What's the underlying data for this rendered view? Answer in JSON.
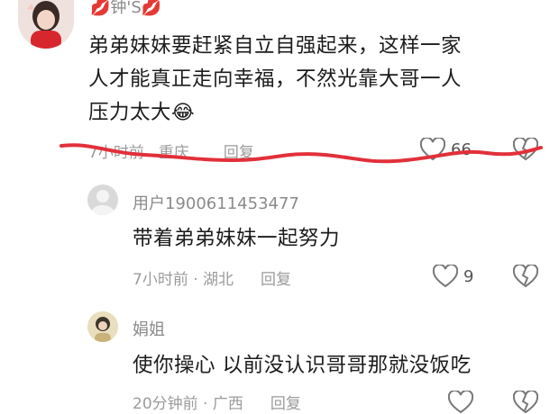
{
  "comment": {
    "username": "💋钟'S💋",
    "text_lines": [
      "弟弟妹妹要赶紧自立自强起来，这样一家",
      "人才能真正走向幸福，不然光靠大哥一人",
      "压力太大"
    ],
    "emoji": "😂",
    "time": "7小时前",
    "location": "重庆",
    "reply_label": "回复",
    "like_count": "66"
  },
  "reply1": {
    "username": "用户1900611453477",
    "text": "带着弟弟妹妹一起努力",
    "time": "7小时前 · 湖北",
    "reply_label": "回复",
    "like_count": "9"
  },
  "reply2": {
    "username": "娟姐",
    "text": "使你操心  以前没认识哥哥那就没饭吃",
    "time": "20分钟前 · 广西",
    "reply_label": "回复"
  },
  "colors": {
    "underline": "#e2303a",
    "text": "#1c1c1c",
    "meta": "#9b9b9b"
  }
}
